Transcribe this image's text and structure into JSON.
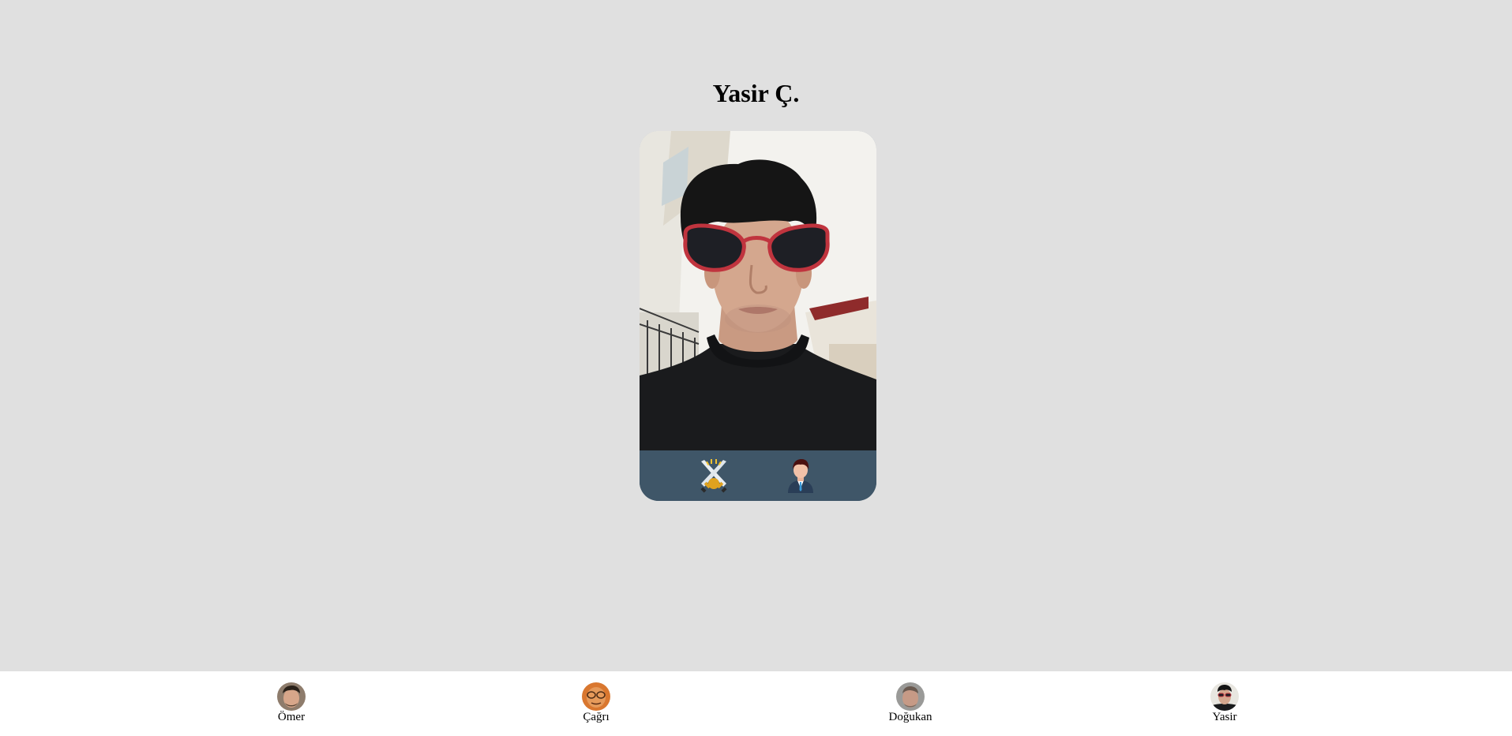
{
  "profile": {
    "title": "Yasir Ç.",
    "photo_alt": "Yasir",
    "actions": [
      {
        "icon": "crossed-swords-icon"
      },
      {
        "icon": "person-suit-icon"
      }
    ]
  },
  "nav": {
    "items": [
      {
        "label": "Ömer"
      },
      {
        "label": "Çağrı"
      },
      {
        "label": "Doğukan"
      },
      {
        "label": "Yasir"
      }
    ]
  },
  "colors": {
    "background": "#e0e0e0",
    "action_bar": "#3f5668",
    "nav_background": "#ffffff"
  }
}
